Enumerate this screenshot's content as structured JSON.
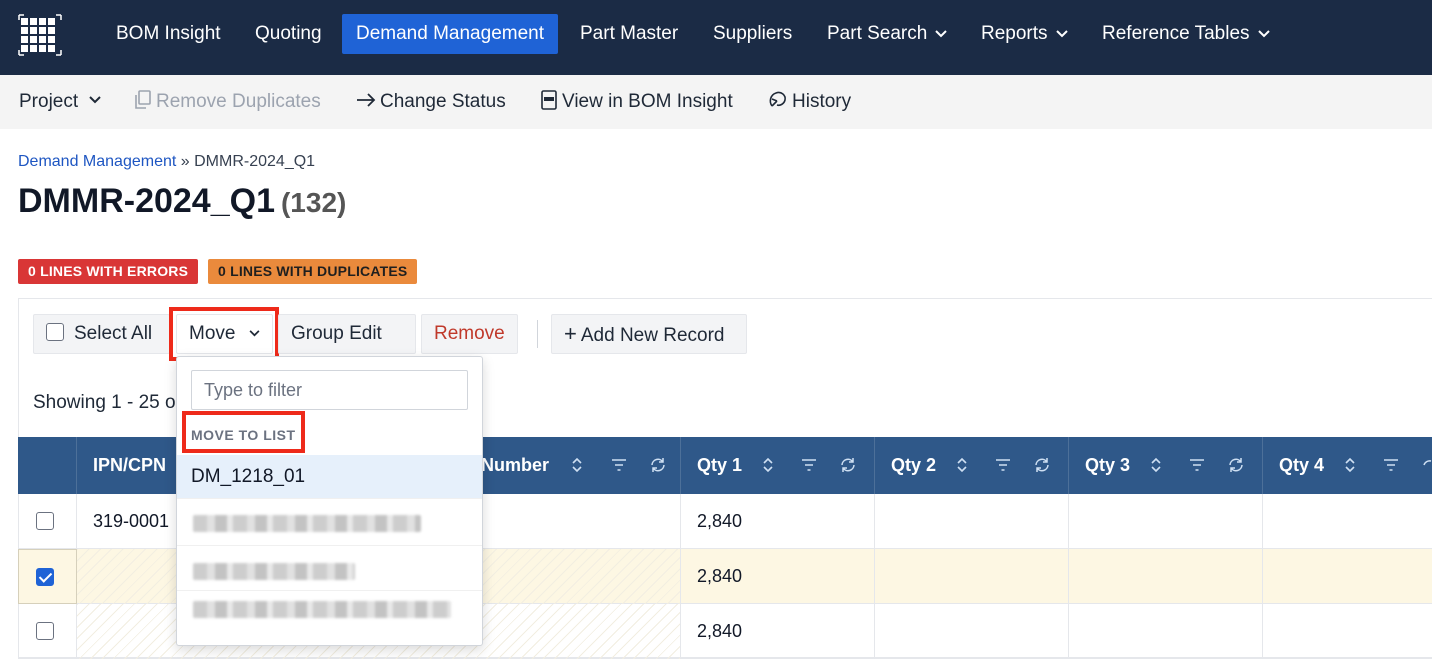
{
  "topnav": {
    "logo": "grid-logo-icon",
    "items": [
      {
        "label": "BOM Insight"
      },
      {
        "label": "Quoting"
      },
      {
        "label": "Demand Management",
        "active": true
      },
      {
        "label": "Part Master"
      },
      {
        "label": "Suppliers"
      },
      {
        "label": "Part Search",
        "dropdown": true
      },
      {
        "label": "Reports",
        "dropdown": true
      },
      {
        "label": "Reference Tables",
        "dropdown": true
      }
    ]
  },
  "subbar": {
    "project": "Project",
    "remove_duplicates": "Remove Duplicates",
    "change_status": "Change Status",
    "view_in_bom": "View in BOM Insight",
    "history": "History"
  },
  "breadcrumb": {
    "parent": "Demand Management",
    "separator": "»",
    "current": "DMMR-2024_Q1"
  },
  "page": {
    "title": "DMMR-2024_Q1",
    "count": "(132)"
  },
  "badges": {
    "errors": "0 LINES WITH ERRORS",
    "duplicates": "0 LINES WITH DUPLICATES"
  },
  "toolbar": {
    "select_all": "Select All",
    "move": "Move",
    "group_edit": "Group Edit",
    "remove": "Remove",
    "add_new": "Add New Record"
  },
  "showing": "Showing 1 - 25 o",
  "table": {
    "headers": [
      "IPN/CPN",
      "Number",
      "Qty 1",
      "Qty 2",
      "Qty 3",
      "Qty 4"
    ],
    "rows": [
      {
        "ipn": "319-0001",
        "qty1": "2,840",
        "checked": false
      },
      {
        "ipn": "",
        "qty1": "2,840",
        "checked": true
      },
      {
        "ipn": "",
        "qty1": "2,840",
        "checked": false
      }
    ]
  },
  "dropdown": {
    "filter_placeholder": "Type to filter",
    "header": "MOVE TO LIST",
    "items": [
      {
        "label": "DM_1218_01"
      }
    ]
  },
  "colors": {
    "nav_bg": "#1b2b45",
    "active": "#1f63d6",
    "table_header": "#2f5889",
    "highlight": "#ee2a1a"
  }
}
